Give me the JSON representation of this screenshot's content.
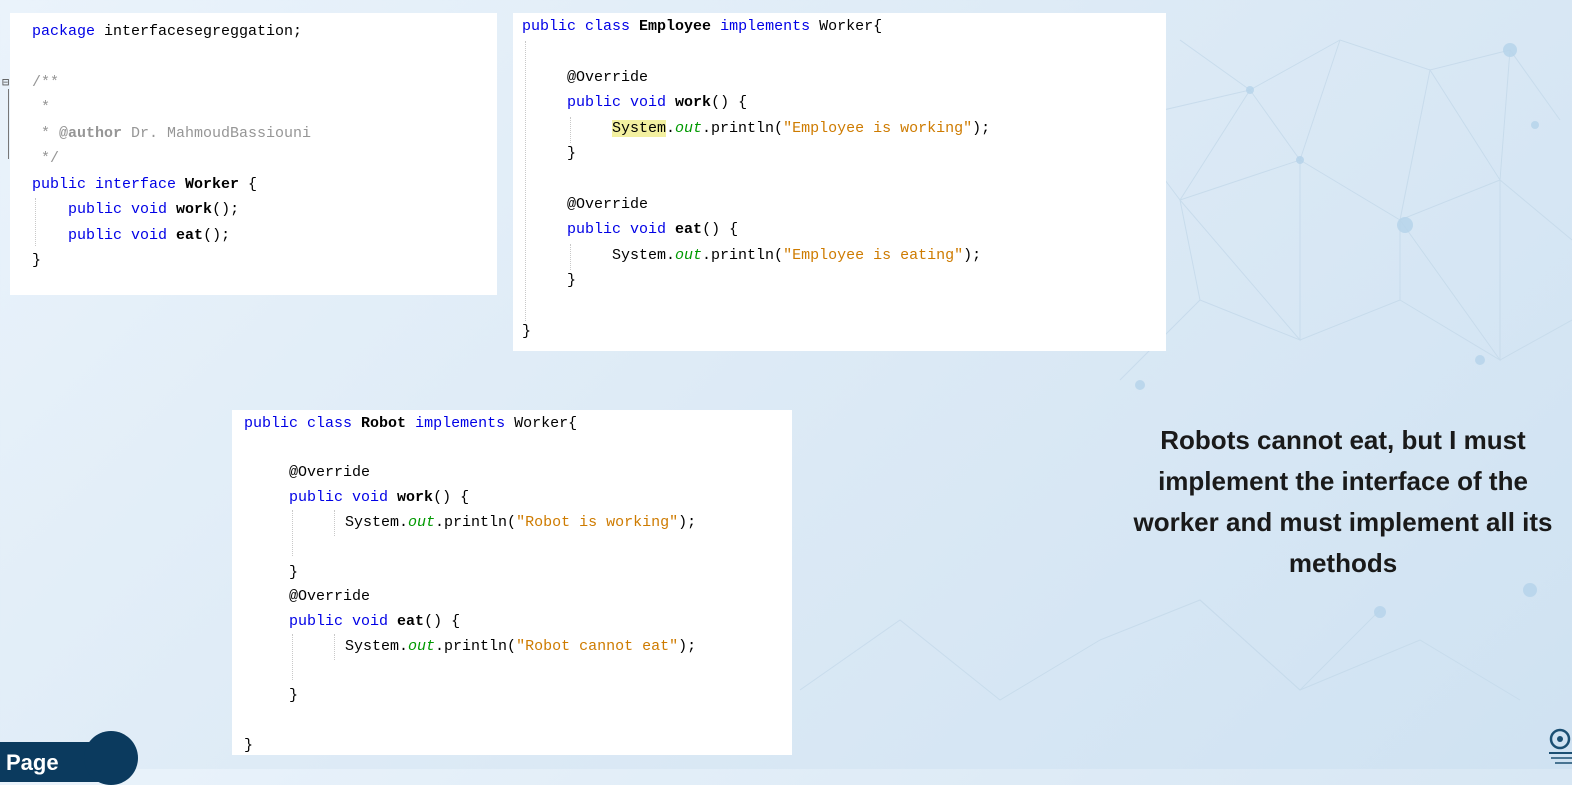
{
  "panel_interface": {
    "lines": [
      "package interfacesegreggation;",
      "/**",
      " *",
      " * @author Dr. MahmoudBassiouni",
      " */",
      "public interface Worker {",
      "    public void work();",
      "    public void eat();",
      "}"
    ]
  },
  "panel_employee": {
    "class_decl": {
      "kw1": "public class",
      "name": "Employee",
      "kw2": "implements",
      "iface": "Worker{"
    },
    "annotation": "@Override",
    "work_sig": {
      "kw": "public void",
      "name": "work",
      "rest": "() {"
    },
    "work_body": {
      "sys": "System",
      "out": "out",
      "call": ".println(",
      "str": "\"Employee is working\"",
      "end": ");"
    },
    "close": "}",
    "eat_sig": {
      "kw": "public void",
      "name": "eat",
      "rest": "() {"
    },
    "eat_body": {
      "sys": "System",
      "out": "out",
      "call": ".println(",
      "str": "\"Employee is eating\"",
      "end": ");"
    }
  },
  "panel_robot": {
    "class_decl": {
      "kw1": "public class",
      "name": "Robot",
      "kw2": "implements",
      "iface": "Worker{"
    },
    "annotation": "@Override",
    "work_sig": {
      "kw": "public void",
      "name": "work",
      "rest": "() {"
    },
    "work_body": {
      "sys": "System",
      "out": "out",
      "call": ".println(",
      "str": "\"Robot is working\"",
      "end": ");"
    },
    "close": "}",
    "eat_sig": {
      "kw": "public void",
      "name": "eat",
      "rest": "() {"
    },
    "eat_body": {
      "sys": "System",
      "out": "out",
      "call": ".println(",
      "str": "\"Robot cannot eat\"",
      "end": ");"
    }
  },
  "caption": "Robots cannot eat, but I must implement the interface of the worker and must implement all its methods",
  "page_label": "Page",
  "colors": {
    "keyword": "#0000e6",
    "string": "#ce7b00",
    "italic_field": "#009900",
    "comment": "#969696",
    "page_tab": "#0b3a5e"
  },
  "icons": {
    "logo": "institution-logo-icon"
  }
}
